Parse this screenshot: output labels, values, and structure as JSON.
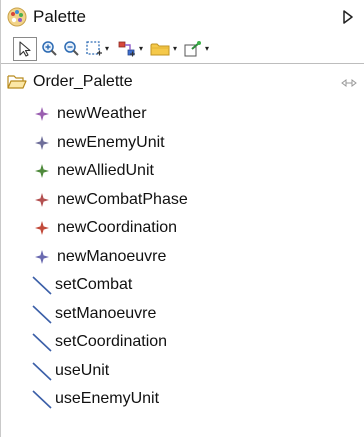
{
  "header": {
    "title": "Palette",
    "logo_icon": "palette-icon",
    "collapse_icon": "triangle-right-icon"
  },
  "toolbar": {
    "items": [
      {
        "name": "select-tool",
        "icon": "pointer-icon"
      },
      {
        "name": "zoom-in-tool",
        "icon": "zoom-in-icon"
      },
      {
        "name": "zoom-out-tool",
        "icon": "zoom-out-icon"
      },
      {
        "name": "marquee-tool",
        "icon": "marquee-icon"
      },
      {
        "name": "connection-tool",
        "icon": "connection-icon"
      },
      {
        "name": "folder-tool",
        "icon": "folder-icon"
      },
      {
        "name": "pin-tool",
        "icon": "note-pin-icon"
      }
    ]
  },
  "drawer": {
    "label": "Order_Palette",
    "icon": "open-folder-icon",
    "pin_icon": "pin-icon"
  },
  "entries": [
    {
      "label": "newWeather",
      "icon": "diamond-star-icon",
      "color": "#9a5fb0"
    },
    {
      "label": "newEnemyUnit",
      "icon": "diamond-star-icon",
      "color": "#6f6f9a"
    },
    {
      "label": "newAlliedUnit",
      "icon": "diamond-star-icon",
      "color": "#4f8a3c"
    },
    {
      "label": "newCombatPhase",
      "icon": "diamond-star-icon",
      "color": "#b35050"
    },
    {
      "label": "newCoordination",
      "icon": "diamond-star-icon",
      "color": "#c24a3a"
    },
    {
      "label": "newManoeuvre",
      "icon": "diamond-star-icon",
      "color": "#6a6ab0"
    },
    {
      "label": "setCombat",
      "icon": "diagonal-line-icon",
      "color": "#3b5fa8"
    },
    {
      "label": "setManoeuvre",
      "icon": "diagonal-line-icon",
      "color": "#3b5fa8"
    },
    {
      "label": "setCoordination",
      "icon": "diagonal-line-icon",
      "color": "#3b5fa8"
    },
    {
      "label": "useUnit",
      "icon": "diagonal-line-icon",
      "color": "#3b5fa8"
    },
    {
      "label": "useEnemyUnit",
      "icon": "diagonal-line-icon",
      "color": "#3b5fa8"
    }
  ]
}
